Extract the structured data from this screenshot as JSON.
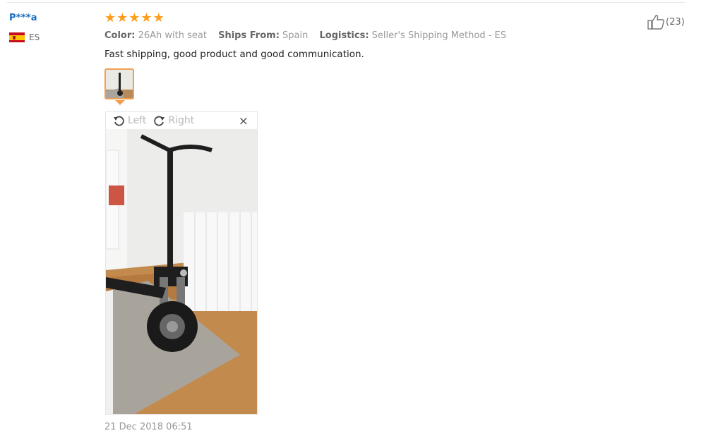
{
  "reviewer": {
    "name": "P***a",
    "country_code": "ES"
  },
  "rating": {
    "stars": 5,
    "max": 5
  },
  "meta": {
    "color_label": "Color:",
    "color_value": "26Ah with seat",
    "ships_label": "Ships From:",
    "ships_value": "Spain",
    "logistics_label": "Logistics:",
    "logistics_value": "Seller's Shipping Method - ES"
  },
  "review_text": "Fast shipping, good product and good communication.",
  "viewer": {
    "rotate_left": "Left",
    "rotate_right": "Right",
    "close": "×"
  },
  "date": "21 Dec 2018 06:51",
  "likes": {
    "count": "(23)"
  },
  "colors": {
    "star": "#ff9c1a",
    "username": "#1a6ec0",
    "thumb_border": "#f0a050"
  }
}
